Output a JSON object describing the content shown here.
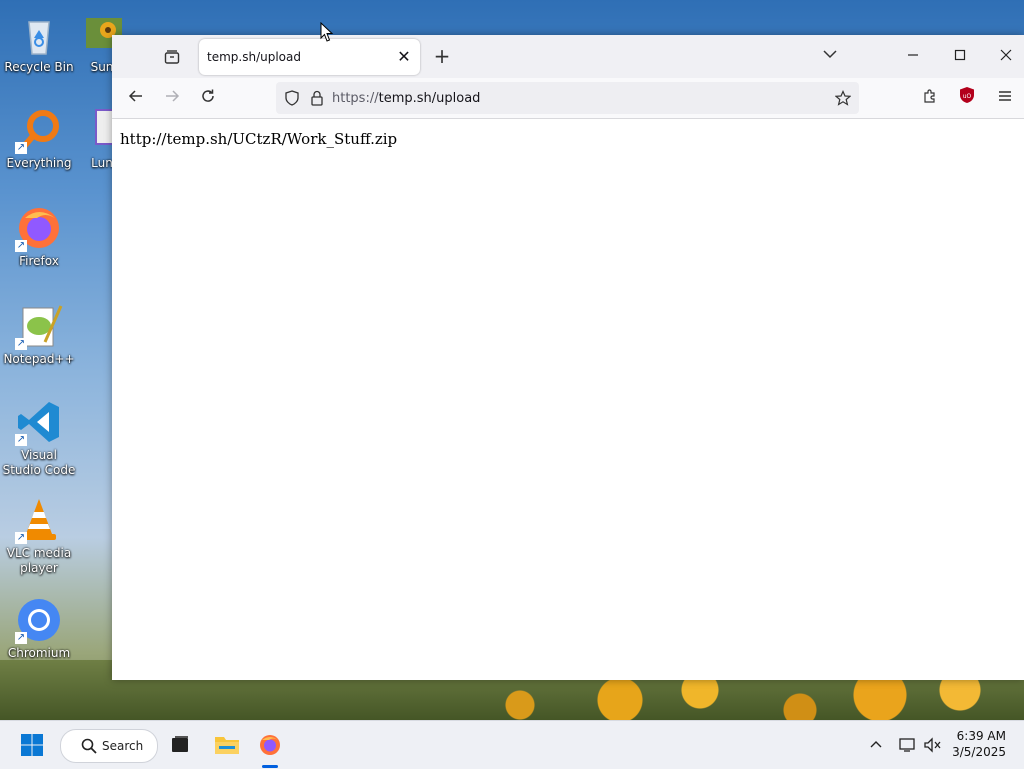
{
  "desktop": {
    "icons": [
      {
        "label": "Recycle Bin"
      },
      {
        "label": "Everything"
      },
      {
        "label": "Firefox"
      },
      {
        "label": "Notepad++"
      },
      {
        "label": "Visual Studio Code"
      },
      {
        "label": "VLC media player"
      },
      {
        "label": "Chromium"
      },
      {
        "label": "Sun"
      },
      {
        "label": "Lun"
      }
    ]
  },
  "browser": {
    "tab_title": "temp.sh/upload",
    "new_tab_glyph": "+",
    "url_prefix": "https://",
    "url_host_path": "temp.sh/upload",
    "page_text": "http://temp.sh/UCtzR/Work_Stuff.zip"
  },
  "taskbar": {
    "search_label": "Search",
    "time": "6:39 AM",
    "date": "3/5/2025"
  },
  "colors": {
    "accent": "#0060df",
    "tab_bg": "#ffffff",
    "toolbar_bg": "#f9f9fb",
    "ublock_red": "#b3001b"
  }
}
